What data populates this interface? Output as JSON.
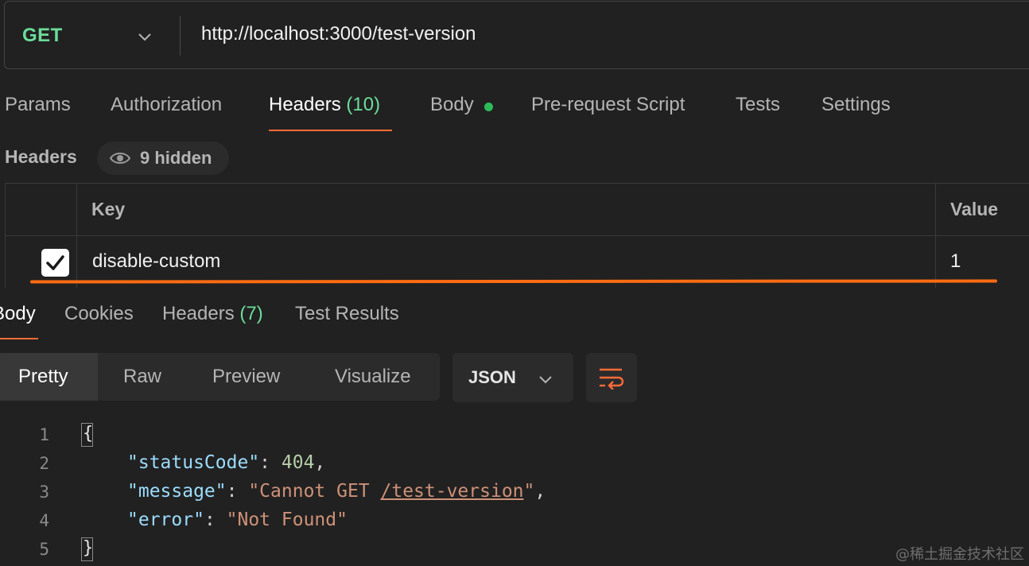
{
  "request": {
    "method": "GET",
    "url": "http://localhost:3000/test-version"
  },
  "request_tabs": {
    "params": "Params",
    "authorization": "Authorization",
    "headers": "Headers",
    "headers_count": "(10)",
    "body": "Body",
    "pre_request": "Pre-request Script",
    "tests": "Tests",
    "settings": "Settings"
  },
  "headers_section": {
    "label": "Headers",
    "hidden": "9 hidden",
    "col_key": "Key",
    "col_value": "Value",
    "rows": [
      {
        "key": "disable-custom",
        "value": "1",
        "checked": true
      }
    ]
  },
  "response_tabs": {
    "body": "Body",
    "cookies": "Cookies",
    "headers": "Headers",
    "headers_count": "(7)",
    "test_results": "Test Results"
  },
  "view_modes": {
    "pretty": "Pretty",
    "raw": "Raw",
    "preview": "Preview",
    "visualize": "Visualize",
    "format": "JSON"
  },
  "code": {
    "line_numbers": [
      "1",
      "2",
      "3",
      "4",
      "5"
    ],
    "open_brace": "{",
    "close_brace": "}",
    "k1": "\"statusCode\"",
    "v1": "404",
    "k2": "\"message\"",
    "v2a": "\"Cannot GET ",
    "v2b": "/test-version",
    "v2c": "\"",
    "k3": "\"error\"",
    "v3": "\"Not Found\"",
    "colon": ": ",
    "comma": ","
  },
  "watermark": "@稀土掘金技术社区",
  "colors": {
    "accent": "#ff6c37",
    "get_method": "#6bdd9a",
    "count": "#6bdd9a",
    "body_dot": "#2dbb5a"
  }
}
